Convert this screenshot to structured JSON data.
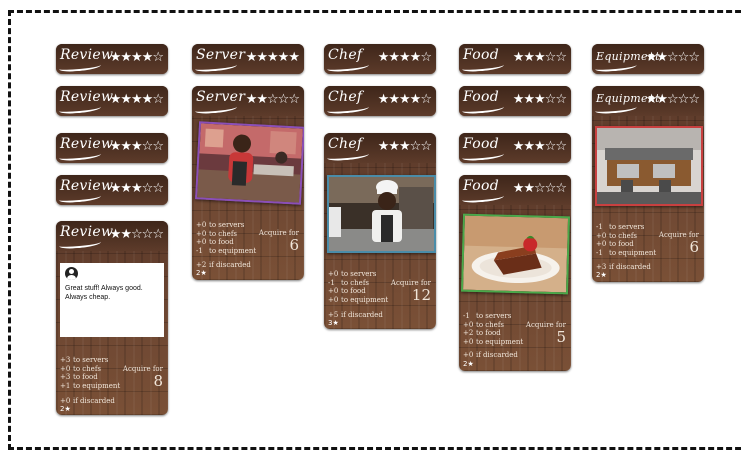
{
  "board": {
    "columns": [
      {
        "name": "review",
        "cards": [
          {
            "title": "Review",
            "stars": "★★★★☆"
          },
          {
            "title": "Review",
            "stars": "★★★★☆"
          },
          {
            "title": "Review",
            "stars": "★★★☆☆"
          },
          {
            "title": "Review",
            "stars": "★★★☆☆"
          },
          {
            "title": "Review",
            "stars": "★★☆☆☆",
            "review_text": "Great stuff! Always good. Always cheap.",
            "stats": [
              {
                "value": "+3",
                "label": "to servers"
              },
              {
                "value": "+0",
                "label": "to chefs"
              },
              {
                "value": "+3",
                "label": "to food"
              },
              {
                "value": "+1",
                "label": "to equipment"
              }
            ],
            "acquire_label": "Acquire for",
            "acquire_cost": "8",
            "discard_value": "+0",
            "discard_label": "if discarded",
            "points": "2★"
          }
        ]
      },
      {
        "name": "server",
        "cards": [
          {
            "title": "Server",
            "stars": "★★★★★"
          },
          {
            "title": "Server",
            "stars": "★★☆☆☆",
            "photo": "server-photo",
            "accent": "#8a4fb8",
            "stats": [
              {
                "value": "+0",
                "label": "to servers"
              },
              {
                "value": "+0",
                "label": "to chefs"
              },
              {
                "value": "+0",
                "label": "to food"
              },
              {
                "value": "-1",
                "label": "to equipment"
              }
            ],
            "acquire_label": "Acquire for",
            "acquire_cost": "6",
            "discard_value": "+2",
            "discard_label": "if discarded",
            "points": "2★"
          }
        ]
      },
      {
        "name": "chef",
        "cards": [
          {
            "title": "Chef",
            "stars": "★★★★☆"
          },
          {
            "title": "Chef",
            "stars": "★★★★☆"
          },
          {
            "title": "Chef",
            "stars": "★★★☆☆",
            "photo": "chef-photo",
            "accent": "#4a8ca8",
            "stats": [
              {
                "value": "+0",
                "label": "to servers"
              },
              {
                "value": "-1",
                "label": "to chefs"
              },
              {
                "value": "+0",
                "label": "to food"
              },
              {
                "value": "+0",
                "label": "to equipment"
              }
            ],
            "acquire_label": "Acquire for",
            "acquire_cost": "12",
            "discard_value": "+5",
            "discard_label": "if discarded",
            "points": "3★"
          }
        ]
      },
      {
        "name": "food",
        "cards": [
          {
            "title": "Food",
            "stars": "★★★☆☆"
          },
          {
            "title": "Food",
            "stars": "★★★☆☆"
          },
          {
            "title": "Food",
            "stars": "★★★☆☆"
          },
          {
            "title": "Food",
            "stars": "★★☆☆☆",
            "photo": "cake-photo",
            "accent": "#4aa84a",
            "stats": [
              {
                "value": "-1",
                "label": "to servers"
              },
              {
                "value": "+0",
                "label": "to chefs"
              },
              {
                "value": "+2",
                "label": "to food"
              },
              {
                "value": "+0",
                "label": "to equipment"
              }
            ],
            "acquire_label": "Acquire for",
            "acquire_cost": "5",
            "discard_value": "+0",
            "discard_label": "if discarded",
            "points": "2★"
          }
        ]
      },
      {
        "name": "equipment",
        "cards": [
          {
            "title": "Equipment",
            "stars": "★★☆☆☆"
          },
          {
            "title": "Equipment",
            "stars": "★★☆☆☆",
            "photo": "espresso-machine-photo",
            "accent": "#c84040",
            "stats": [
              {
                "value": "-1",
                "label": "to servers"
              },
              {
                "value": "+0",
                "label": "to chefs"
              },
              {
                "value": "+0",
                "label": "to food"
              },
              {
                "value": "-1",
                "label": "to equipment"
              }
            ],
            "acquire_label": "Acquire for",
            "acquire_cost": "6",
            "discard_value": "+3",
            "discard_label": "if discarded",
            "points": "2★"
          }
        ]
      }
    ]
  }
}
